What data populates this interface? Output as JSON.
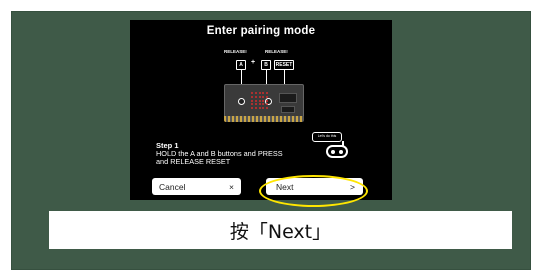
{
  "screen": {
    "title": "Enter pairing mode",
    "release_labels": [
      "RELEASE!",
      "RELEASE!"
    ],
    "buttons": [
      "A",
      "B"
    ],
    "plus": "+",
    "reset_label": "RESET",
    "bubble_text": "Let's do this",
    "step_title": "Step 1",
    "step_text": "HOLD the A and B buttons and PRESS and RELEASE RESET"
  },
  "footer": {
    "cancel_label": "Cancel",
    "cancel_icon": "×",
    "next_label": "Next",
    "next_icon": ">"
  },
  "caption": "按「Next」",
  "colors": {
    "frame_bg": "#3f5a48",
    "highlight": "#ffe600"
  }
}
